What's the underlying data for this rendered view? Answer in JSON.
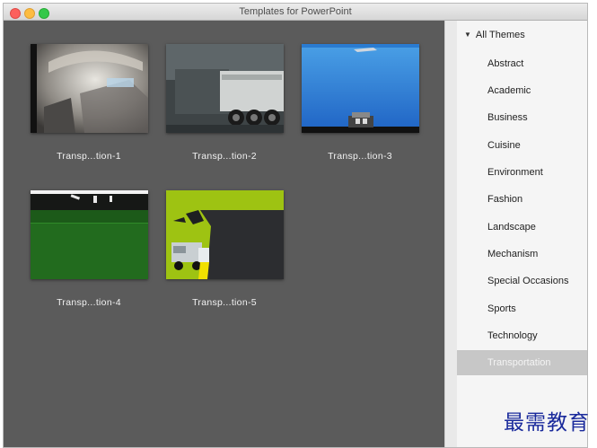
{
  "window": {
    "title": "Templates for PowerPoint"
  },
  "gallery": {
    "templates": [
      {
        "label": "Transp...tion-1"
      },
      {
        "label": "Transp...tion-2"
      },
      {
        "label": "Transp...tion-3"
      },
      {
        "label": "Transp...tion-4"
      },
      {
        "label": "Transp...tion-5"
      }
    ]
  },
  "sidebar": {
    "header": "All Themes",
    "items": [
      {
        "label": "Abstract"
      },
      {
        "label": "Academic"
      },
      {
        "label": "Business"
      },
      {
        "label": "Cuisine"
      },
      {
        "label": "Environment"
      },
      {
        "label": "Fashion"
      },
      {
        "label": "Landscape"
      },
      {
        "label": "Mechanism"
      },
      {
        "label": "Special Occasions"
      },
      {
        "label": "Sports"
      },
      {
        "label": "Technology"
      },
      {
        "label": "Transportation"
      }
    ],
    "selected": "Transportation"
  },
  "watermark": "最需教育",
  "colors": {
    "gallery_bg": "#5b5b5b",
    "sidebar_bg": "#f5f5f5",
    "selection": "#c7c7c7"
  }
}
